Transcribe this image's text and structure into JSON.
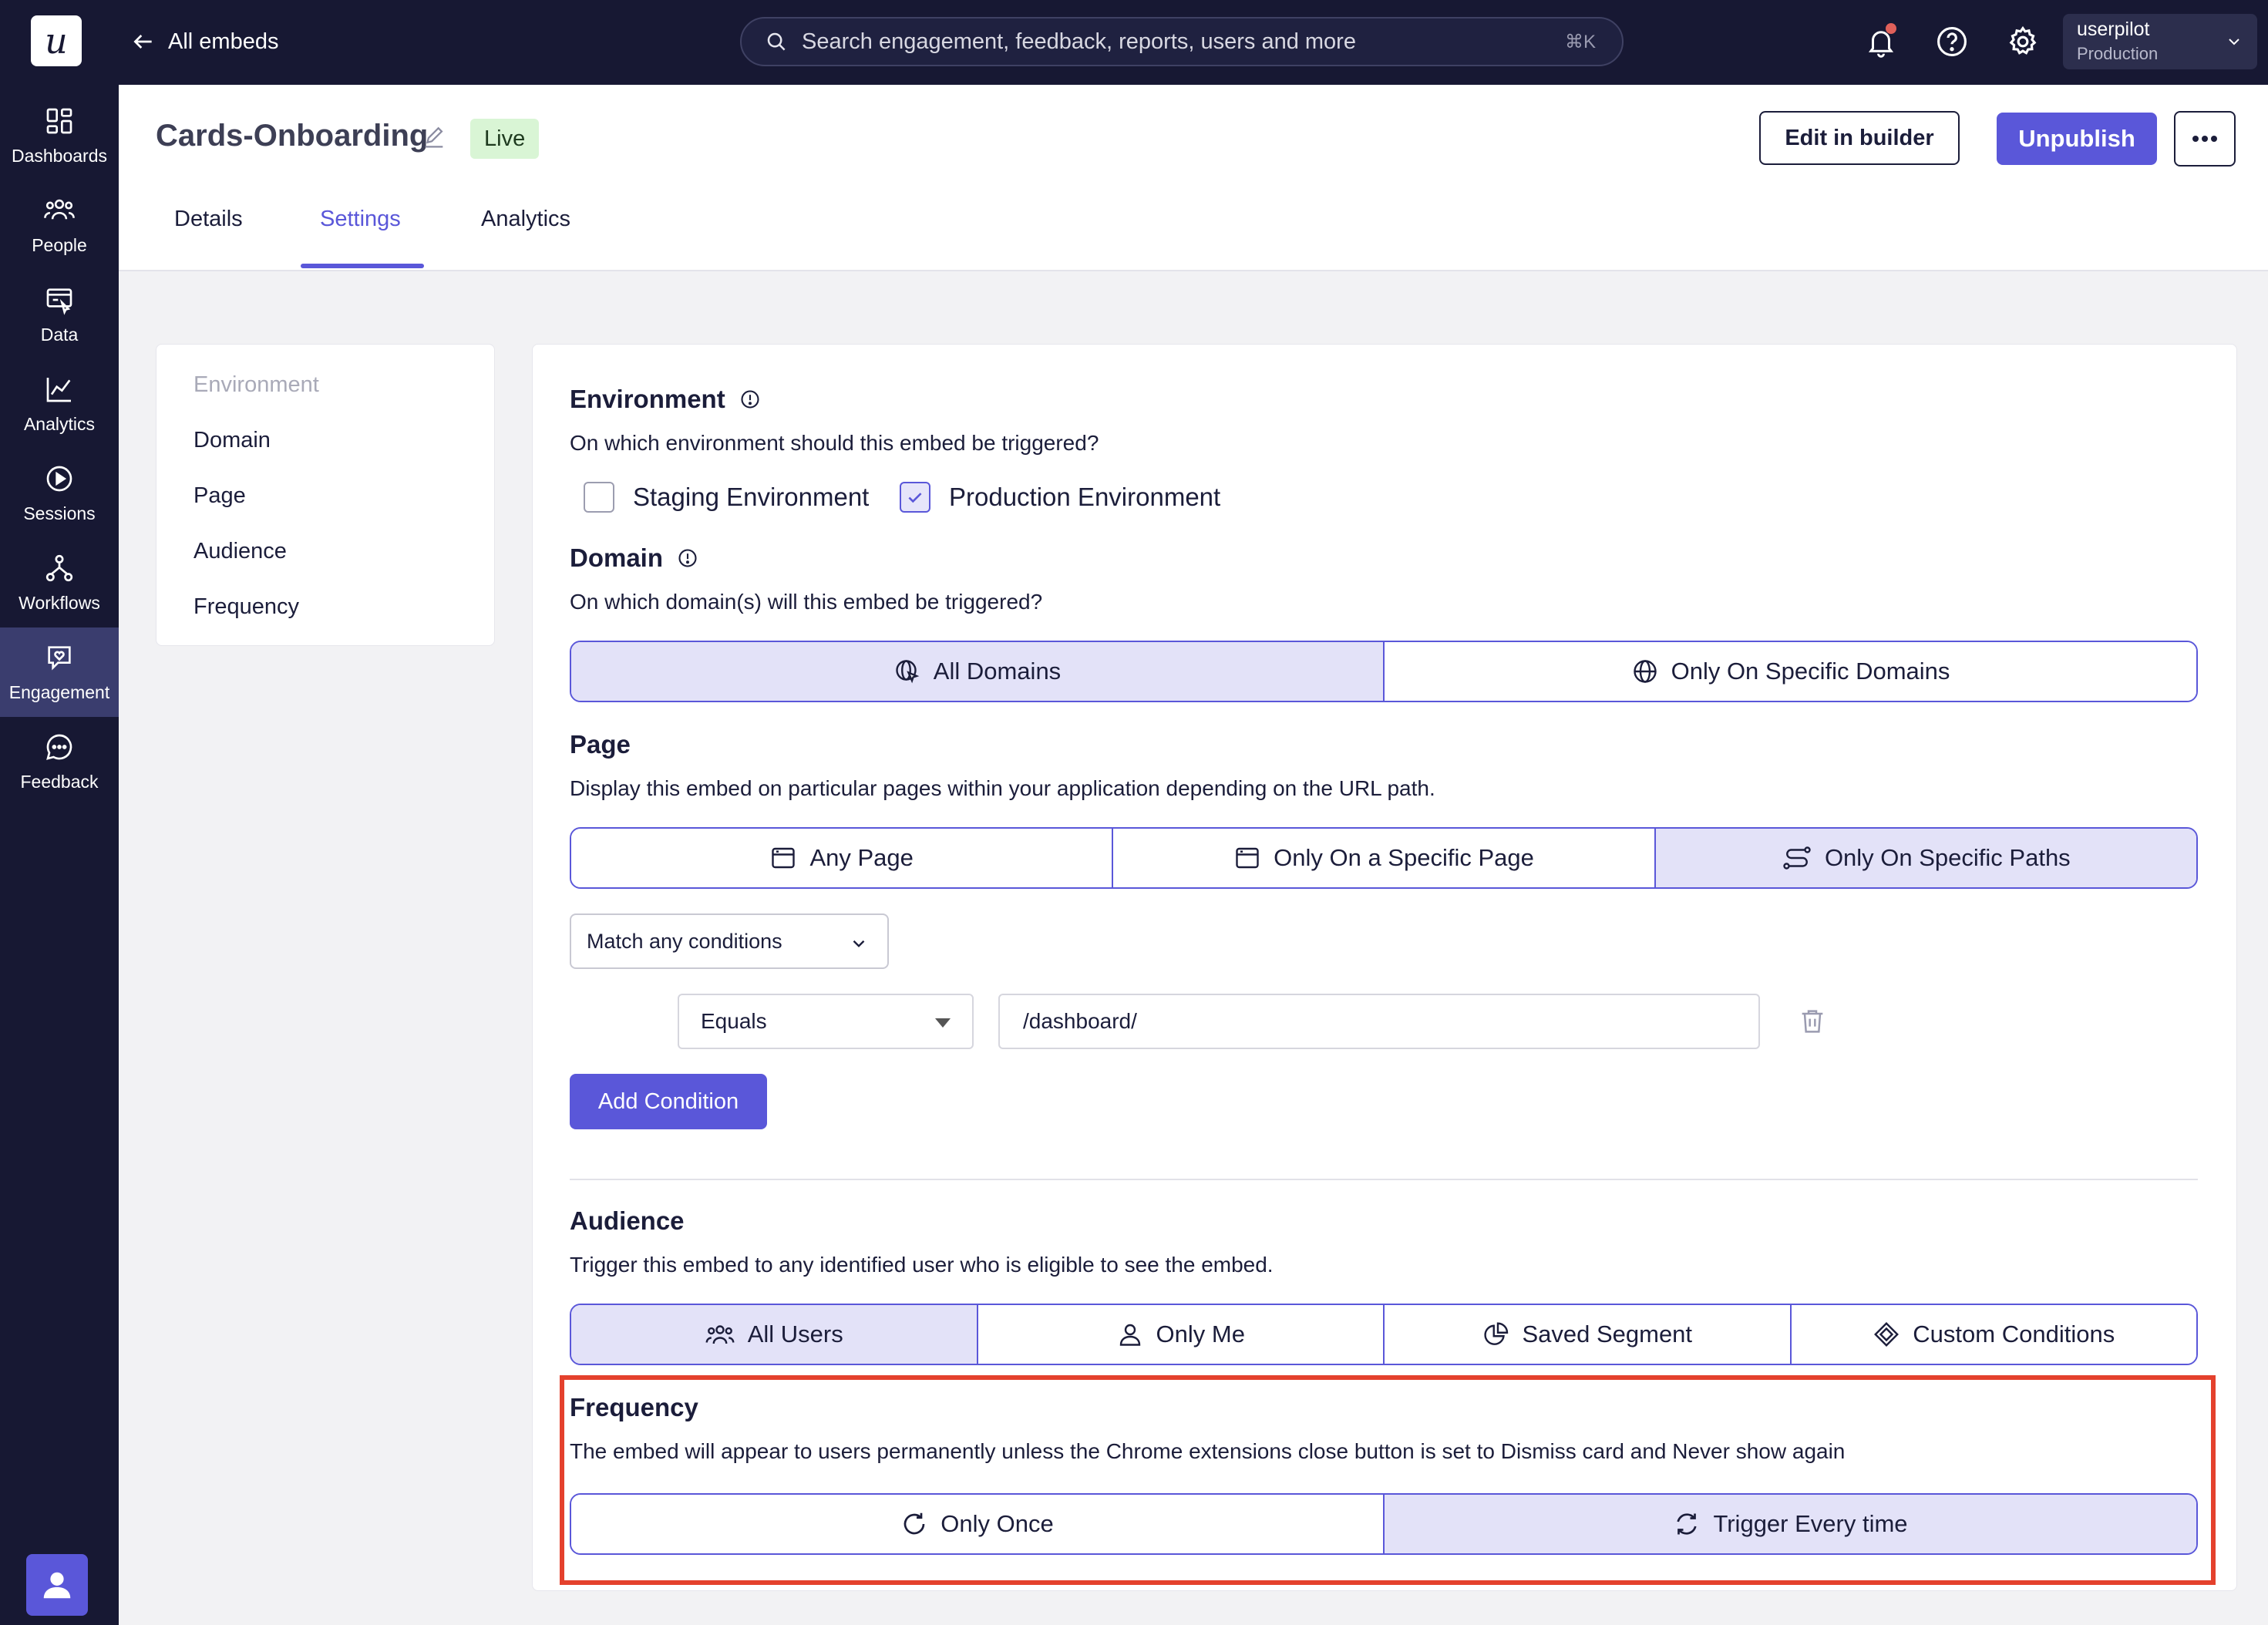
{
  "sidebar": {
    "logo": "u",
    "items": [
      {
        "label": "Dashboards",
        "icon": "dashboard-icon",
        "active": false
      },
      {
        "label": "People",
        "icon": "people-icon",
        "active": false
      },
      {
        "label": "Data",
        "icon": "data-icon",
        "active": false
      },
      {
        "label": "Analytics",
        "icon": "analytics-icon",
        "active": false
      },
      {
        "label": "Sessions",
        "icon": "sessions-icon",
        "active": false
      },
      {
        "label": "Workflows",
        "icon": "workflows-icon",
        "active": false
      },
      {
        "label": "Engagement",
        "icon": "engagement-icon",
        "active": true
      },
      {
        "label": "Feedback",
        "icon": "feedback-icon",
        "active": false
      }
    ]
  },
  "topbar": {
    "back_label": "All embeds",
    "search_placeholder": "Search engagement, feedback, reports, users and more",
    "search_shortcut": "⌘K",
    "account_name": "userpilot",
    "account_env": "Production"
  },
  "header": {
    "title": "Cards-Onboarding",
    "status": "Live",
    "edit_builder_label": "Edit in builder",
    "unpublish_label": "Unpublish",
    "tabs": [
      "Details",
      "Settings",
      "Analytics"
    ],
    "active_tab": "Settings"
  },
  "section_nav": {
    "items": [
      "Environment",
      "Domain",
      "Page",
      "Audience",
      "Frequency"
    ]
  },
  "environment": {
    "title": "Environment",
    "description": "On which environment should this embed be triggered?",
    "staging_label": "Staging Environment",
    "staging_checked": false,
    "production_label": "Production Environment",
    "production_checked": true
  },
  "domain": {
    "title": "Domain",
    "description": "On which domain(s) will this embed be triggered?",
    "options": [
      "All Domains",
      "Only On Specific Domains"
    ],
    "selected": "All Domains"
  },
  "page": {
    "title": "Page",
    "description": "Display this embed on particular pages within your application depending on the URL path.",
    "options": [
      "Any Page",
      "Only On a Specific Page",
      "Only On Specific Paths"
    ],
    "selected": "Only On Specific Paths",
    "match_select": "Match any conditions",
    "condition_operator": "Equals",
    "condition_value": "/dashboard/",
    "add_condition_label": "Add Condition"
  },
  "audience": {
    "title": "Audience",
    "description": "Trigger this embed to any identified user who is eligible to see the embed.",
    "options": [
      "All Users",
      "Only Me",
      "Saved Segment",
      "Custom Conditions"
    ],
    "selected": "All Users"
  },
  "frequency": {
    "title": "Frequency",
    "description": "The embed will appear to users permanently unless the Chrome extensions close button is set to Dismiss card and Never show again",
    "options": [
      "Only Once",
      "Trigger Every time"
    ],
    "selected": "Trigger Every time"
  },
  "colors": {
    "accent": "#5a57d9",
    "sidebar_bg": "#171833",
    "selected_option_bg": "#e3e2f8",
    "live_badge_bg": "#d9f5d5",
    "highlight": "#e4412d"
  }
}
